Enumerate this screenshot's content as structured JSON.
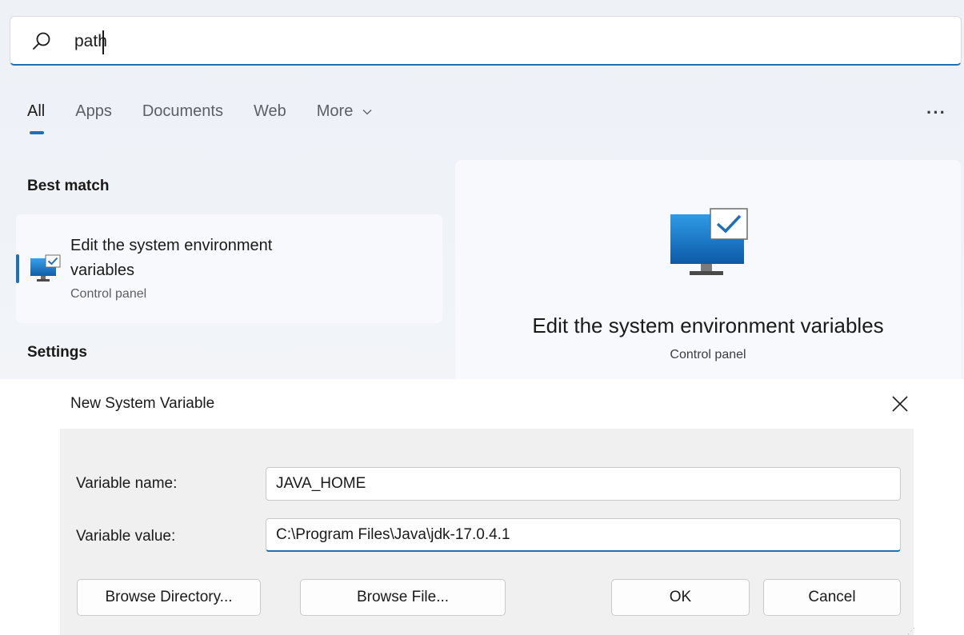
{
  "search": {
    "query": "path"
  },
  "tabs": [
    {
      "label": "All",
      "active": true
    },
    {
      "label": "Apps",
      "active": false
    },
    {
      "label": "Documents",
      "active": false
    },
    {
      "label": "Web",
      "active": false
    },
    {
      "label": "More",
      "active": false
    }
  ],
  "more_menu_label": "···",
  "sections": {
    "best_match": "Best match",
    "settings": "Settings"
  },
  "result": {
    "title": "Edit the system environment variables",
    "subtitle": "Control panel",
    "icon": "monitor-check-icon"
  },
  "preview": {
    "title": "Edit the system environment variables",
    "subtitle": "Control panel",
    "icon": "monitor-check-icon"
  },
  "dialog": {
    "title": "New System Variable",
    "name_label": "Variable name:",
    "name_value": "JAVA_HOME",
    "value_label": "Variable value:",
    "value_value": "C:\\Program Files\\Java\\jdk-17.0.4.1",
    "buttons": {
      "browse_directory": "Browse Directory...",
      "browse_file": "Browse File...",
      "ok": "OK",
      "cancel": "Cancel"
    }
  },
  "colors": {
    "accent": "#1f6fb5",
    "panel_bg": "#eef2f7",
    "dialog_body_bg": "#f0f0f0"
  }
}
